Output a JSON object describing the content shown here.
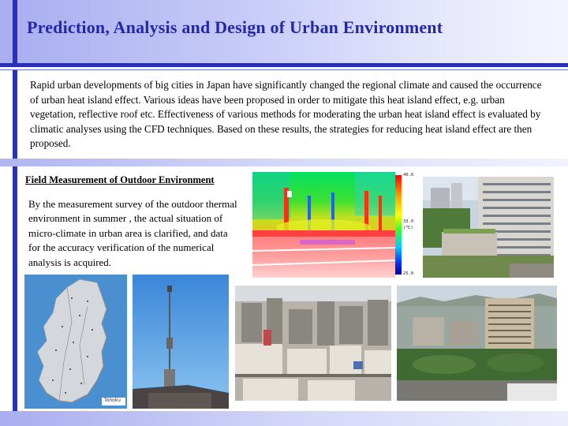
{
  "title": "Prediction, Analysis and Design of Urban Environment",
  "intro": "Rapid urban developments of big cities in Japan have significantly changed the regional climate and caused the occurrence of urban heat island effect. Various ideas have been proposed in order to mitigate this heat island effect, e.g. urban vegetation, reflective roof etc. Effectiveness of various methods for moderating the urban heat island effect is evaluated by climatic analyses using the CFD techniques. Based on these results, the strategies for reducing heat island effect are then proposed.",
  "section": {
    "heading": "Field Measurement of Outdoor Environment",
    "body": "By the measurement survey of the outdoor thermal environment in summer , the actual situation of micro-climate in urban area is clarified, and data for the accuracy verification of the numerical analysis is acquired."
  },
  "thermal_scale": {
    "max": "40.0",
    "mid": "33.0",
    "unit": "(℃)",
    "min": "25.0"
  },
  "map_legend": "Tohoku",
  "colors": {
    "accent": "#2a2fb8",
    "title_text": "#2228a8",
    "band_light": "#c8ccf8"
  }
}
